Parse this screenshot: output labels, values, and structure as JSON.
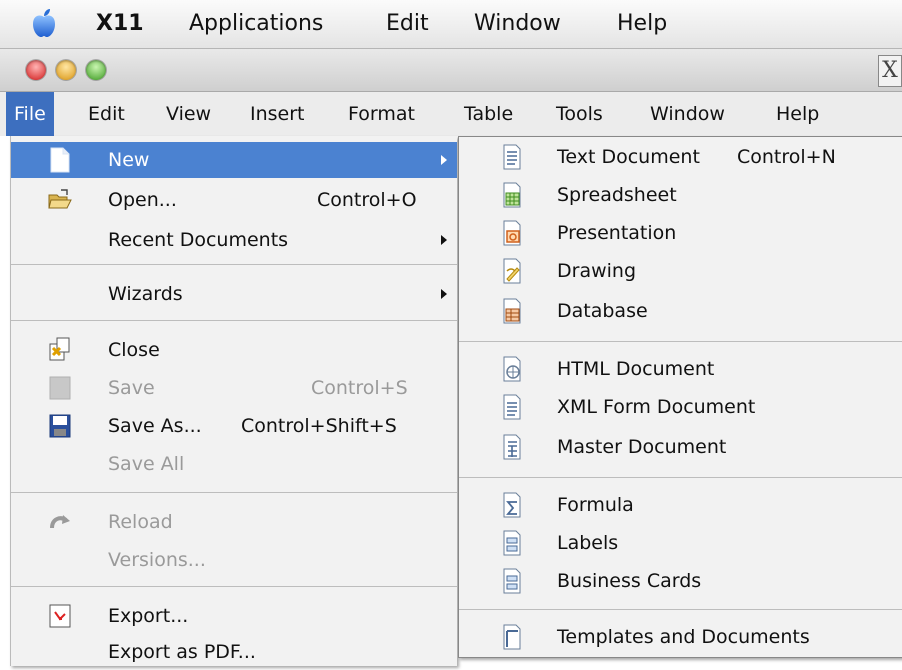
{
  "mac_menubar": {
    "app_name": "X11",
    "items": [
      "Applications",
      "Edit",
      "Window",
      "Help"
    ]
  },
  "titlebar": {
    "close_label": "X"
  },
  "app_menubar": {
    "items": [
      "File",
      "Edit",
      "View",
      "Insert",
      "Format",
      "Table",
      "Tools",
      "Window",
      "Help"
    ]
  },
  "file_menu": {
    "new": "New",
    "open": "Open...",
    "open_accel": "Control+O",
    "recent": "Recent Documents",
    "wizards": "Wizards",
    "close": "Close",
    "save": "Save",
    "save_accel": "Control+S",
    "save_as": "Save As...",
    "save_as_accel": "Control+Shift+S",
    "save_all": "Save All",
    "reload": "Reload",
    "versions": "Versions...",
    "export": "Export...",
    "export_pdf": "Export as PDF..."
  },
  "new_menu": {
    "text_document": "Text Document",
    "text_document_accel": "Control+N",
    "spreadsheet": "Spreadsheet",
    "presentation": "Presentation",
    "drawing": "Drawing",
    "database": "Database",
    "html_document": "HTML Document",
    "xml_form": "XML Form Document",
    "master_document": "Master Document",
    "formula": "Formula",
    "labels": "Labels",
    "business_cards": "Business Cards",
    "templates": "Templates and Documents"
  },
  "colors": {
    "highlight": "#4b82d1",
    "active_menu": "#3d6fbf",
    "disabled_text": "#9a9a9a"
  }
}
